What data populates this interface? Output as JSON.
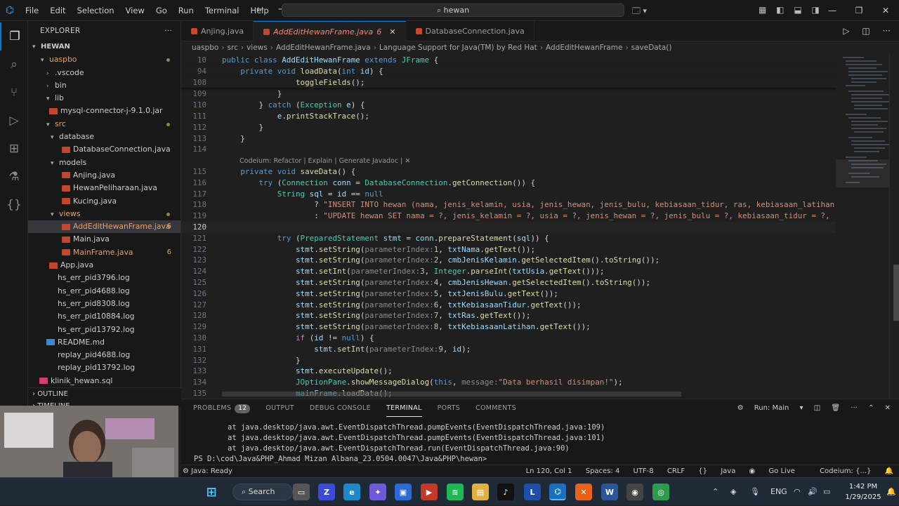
{
  "menubar": {
    "items": [
      "File",
      "Edit",
      "Selection",
      "View",
      "Go",
      "Run",
      "Terminal",
      "Help"
    ],
    "command_center": "hewan"
  },
  "explorer": {
    "title": "EXPLORER",
    "root": "HEWAN",
    "items": [
      {
        "label": "uaspbo",
        "type": "folder",
        "open": true,
        "color": "orange",
        "dot": true
      },
      {
        "label": ".vscode",
        "type": "folder",
        "open": false,
        "color": "gray"
      },
      {
        "label": "bin",
        "type": "folder",
        "open": false,
        "color": "gray"
      },
      {
        "label": "lib",
        "type": "folder",
        "open": true,
        "color": "gray"
      },
      {
        "label": "mysql-connector-j-9.1.0.jar",
        "type": "file",
        "color": "gray"
      },
      {
        "label": "src",
        "type": "folder",
        "open": true,
        "color": "orange",
        "dot": true
      },
      {
        "label": "database",
        "type": "folder",
        "open": true,
        "color": "gray"
      },
      {
        "label": "DatabaseConnection.java",
        "type": "file",
        "color": "gray"
      },
      {
        "label": "models",
        "type": "folder",
        "open": true,
        "color": "gray"
      },
      {
        "label": "Anjing.java",
        "type": "file",
        "color": "gray"
      },
      {
        "label": "HewanPeliharaan.java",
        "type": "file",
        "color": "gray"
      },
      {
        "label": "Kucing.java",
        "type": "file",
        "color": "gray"
      },
      {
        "label": "views",
        "type": "folder",
        "open": true,
        "color": "orange",
        "dot": true
      },
      {
        "label": "AddEditHewanFrame.java",
        "type": "file",
        "color": "orange",
        "badge": "6",
        "selected": true
      },
      {
        "label": "Main.java",
        "type": "file",
        "color": "gray"
      },
      {
        "label": "MainFrame.java",
        "type": "file",
        "color": "orange",
        "badge": "6"
      },
      {
        "label": "App.java",
        "type": "file",
        "color": "gray"
      },
      {
        "label": "hs_err_pid3796.log",
        "type": "file",
        "color": "gray"
      },
      {
        "label": "hs_err_pid4688.log",
        "type": "file",
        "color": "gray"
      },
      {
        "label": "hs_err_pid8308.log",
        "type": "file",
        "color": "gray"
      },
      {
        "label": "hs_err_pid10884.log",
        "type": "file",
        "color": "gray"
      },
      {
        "label": "hs_err_pid13792.log",
        "type": "file",
        "color": "gray"
      },
      {
        "label": "README.md",
        "type": "file",
        "color": "gray"
      },
      {
        "label": "replay_pid4688.log",
        "type": "file",
        "color": "gray"
      },
      {
        "label": "replay_pid13792.log",
        "type": "file",
        "color": "gray"
      },
      {
        "label": "klinik_hewan.sql",
        "type": "file",
        "color": "gray"
      }
    ],
    "outline": "OUTLINE",
    "timeline": "TIMELINE"
  },
  "tabs": [
    {
      "label": "Anjing.java",
      "active": false
    },
    {
      "label": "AddEditHewanFrame.java",
      "active": true,
      "count": "6"
    },
    {
      "label": "DatabaseConnection.java",
      "active": false
    }
  ],
  "breadcrumb": [
    "uaspbo",
    "src",
    "views",
    "AddEditHewanFrame.java",
    "Language Support for Java(TM) by Red Hat",
    "AddEditHewanFrame",
    "saveData()"
  ],
  "codelens": "Codeium: Refactor | Explain | Generate Javadoc | ✕",
  "code": {
    "sticky": [
      {
        "n": "10",
        "t": "public class AddEditHewanFrame extends JFrame {"
      },
      {
        "n": "94",
        "t": "    private void loadData(int id) {"
      },
      {
        "n": "108",
        "t": "                toggleFields();"
      }
    ],
    "lines": [
      {
        "n": "109",
        "t": "            }"
      },
      {
        "n": "110",
        "t": "        } catch (Exception e) {"
      },
      {
        "n": "111",
        "t": "            e.printStackTrace();"
      },
      {
        "n": "112",
        "t": "        }"
      },
      {
        "n": "113",
        "t": "    }"
      },
      {
        "n": "114",
        "t": ""
      },
      {
        "n": "115",
        "t": "    private void saveData() {"
      },
      {
        "n": "116",
        "t": "        try (Connection conn = DatabaseConnection.getConnection()) {"
      },
      {
        "n": "117",
        "t": "            String sql = id == null"
      },
      {
        "n": "118",
        "t": "                    ? \"INSERT INTO hewan (nama, jenis_kelamin, usia, jenis_hewan, jenis_bulu, kebiasaan_tidur, ras, kebiasaan_latihan) V"
      },
      {
        "n": "119",
        "t": "                    : \"UPDATE hewan SET nama = ?, jenis_kelamin = ?, usia = ?, jenis_hewan = ?, jenis_bulu = ?, kebiasaan_tidur = ?, ras"
      },
      {
        "n": "120",
        "t": ""
      },
      {
        "n": "121",
        "t": "            try (PreparedStatement stmt = conn.prepareStatement(sql)) {"
      },
      {
        "n": "122",
        "t": "                stmt.setString(parameterIndex:1, txtNama.getText());"
      },
      {
        "n": "123",
        "t": "                stmt.setString(parameterIndex:2, cmbJenisKelamin.getSelectedItem().toString());"
      },
      {
        "n": "124",
        "t": "                stmt.setInt(parameterIndex:3, Integer.parseInt(txtUsia.getText()));"
      },
      {
        "n": "125",
        "t": "                stmt.setString(parameterIndex:4, cmbJenisHewan.getSelectedItem().toString());"
      },
      {
        "n": "126",
        "t": "                stmt.setString(parameterIndex:5, txtJenisBulu.getText());"
      },
      {
        "n": "127",
        "t": "                stmt.setString(parameterIndex:6, txtKebiasaanTidur.getText());"
      },
      {
        "n": "128",
        "t": "                stmt.setString(parameterIndex:7, txtRas.getText());"
      },
      {
        "n": "129",
        "t": "                stmt.setString(parameterIndex:8, txtKebiasaanLatihan.getText());"
      },
      {
        "n": "130",
        "t": "                if (id != null) {"
      },
      {
        "n": "131",
        "t": "                    stmt.setInt(parameterIndex:9, id);"
      },
      {
        "n": "132",
        "t": "                }"
      },
      {
        "n": "133",
        "t": "                stmt.executeUpdate();"
      },
      {
        "n": "134",
        "t": "                JOptionPane.showMessageDialog(this, message:\"Data berhasil disimpan!\");"
      },
      {
        "n": "135",
        "t": "                mainFrame.loadData();"
      }
    ],
    "current_line": "120"
  },
  "panel": {
    "tabs": [
      {
        "label": "PROBLEMS",
        "badge": "12"
      },
      {
        "label": "OUTPUT"
      },
      {
        "label": "DEBUG CONSOLE"
      },
      {
        "label": "TERMINAL",
        "active": true
      },
      {
        "label": "PORTS"
      },
      {
        "label": "COMMENTS"
      }
    ],
    "run_label": "Run: Main",
    "terminal": [
      "at java.desktop/java.awt.EventDispatchThread.pumpEvents(EventDispatchThread.java:109)",
      "at java.desktop/java.awt.EventDispatchThread.pumpEvents(EventDispatchThread.java:101)",
      "at java.desktop/java.awt.EventDispatchThread.run(EventDispatchThread.java:90)"
    ],
    "prompt": "PS D:\\cod\\Java&PHP_Ahmad Mizan Albana_23.0504.0047\\Java&PHP\\hewan>"
  },
  "statusbar": {
    "left": "Java: Ready",
    "position": "Ln 120, Col 1",
    "spaces": "Spaces: 4",
    "encoding": "UTF-8",
    "eol": "CRLF",
    "language": "Java",
    "golive": "Go Live",
    "codeium": "Codeium: {...}"
  },
  "taskbar": {
    "search": "Search",
    "lang": "ENG",
    "time": "1:42 PM",
    "date": "1/29/2025"
  },
  "colors": {
    "accent": "#0078d4",
    "modified": "#e2a36a",
    "error": "#f48771"
  }
}
